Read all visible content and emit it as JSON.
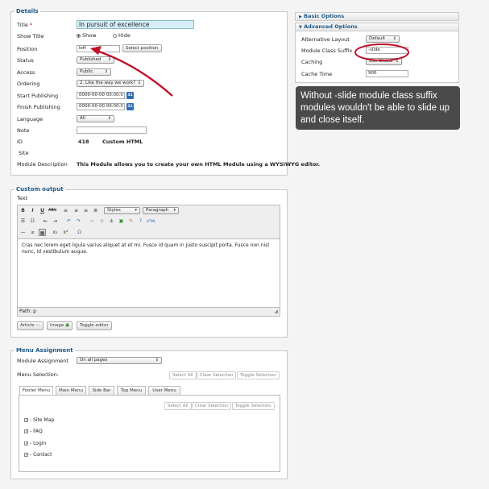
{
  "details": {
    "legend": "Details",
    "title_label": "Title",
    "required_mark": "*",
    "title_value": "In pursuit of excellence",
    "show_title_label": "Show Title",
    "show_option": "Show",
    "hide_option": "Hide",
    "position_label": "Position",
    "position_value": "left",
    "select_position_button": "Select position",
    "status_label": "Status",
    "status_value": "Published",
    "access_label": "Access",
    "access_value": "Public",
    "ordering_label": "Ordering",
    "ordering_value": "2. Like the way we work?",
    "start_publishing_label": "Start Publishing",
    "start_publishing_value": "0000-00-00 00:00:0",
    "finish_publishing_label": "Finish Publishing",
    "finish_publishing_value": "0000-00-00 00:00:0",
    "calendar_icon_text": "31",
    "language_label": "Language",
    "language_value": "All",
    "note_label": "Note",
    "note_value": "",
    "id_label": "ID",
    "id_value": "418",
    "module_type": "Custom HTML",
    "site_label": "Site",
    "module_description_label": "Module Description",
    "module_description_value": "This Module allows you to create your own HTML Module using a WYSIWYG editor."
  },
  "options": {
    "basic_title": "Basic Options",
    "advanced_title": "Advanced Options",
    "alternative_layout_label": "Alternative Layout",
    "alternative_layout_value": "Default",
    "module_class_suffix_label": "Module Class Suffix",
    "module_class_suffix_value": "-slide",
    "caching_label": "Caching",
    "caching_value": "Use Global",
    "cache_time_label": "Cache Time",
    "cache_time_value": "900",
    "expand_icon": "▶",
    "collapse_icon": "▼"
  },
  "tooltip": {
    "text": "Without -slide module class suffix modules wouldn't be able to slide up and close itself."
  },
  "custom_output": {
    "legend": "Custom output",
    "text_label": "Text",
    "styles_value": "Styles",
    "paragraph_value": "Paragraph",
    "editor_content": "Cras nec lorem eget ligula varius aliquet at et mi. Fusce id quam in justo suscipit porta. Fusce non nisl nunc, id vestibulum augue.",
    "path_label": "Path: p",
    "article_button": "Article",
    "image_button": "Image",
    "toggle_editor_button": "Toggle editor"
  },
  "menu_assignment": {
    "legend": "Menu Assignment",
    "module_assignment_label": "Module Assignment",
    "module_assignment_value": "On all pages",
    "menu_selection_label": "Menu Selection:",
    "select_all": "Select All",
    "clear_selection": "Clear Selection",
    "toggle_selection": "Toggle Selection",
    "tabs": [
      "Footer Menu",
      "Main Menu",
      "Side Bar",
      "Top Menu",
      "User Menu"
    ],
    "items": [
      "- Site Map",
      "- FAQ",
      "- Login",
      "- Contact"
    ]
  },
  "colors": {
    "legend_blue": "#1d5a8c",
    "title_highlight": "#d6eefa",
    "annotation_red": "#c0102a",
    "tooltip_bg": "#4a4a4a"
  }
}
